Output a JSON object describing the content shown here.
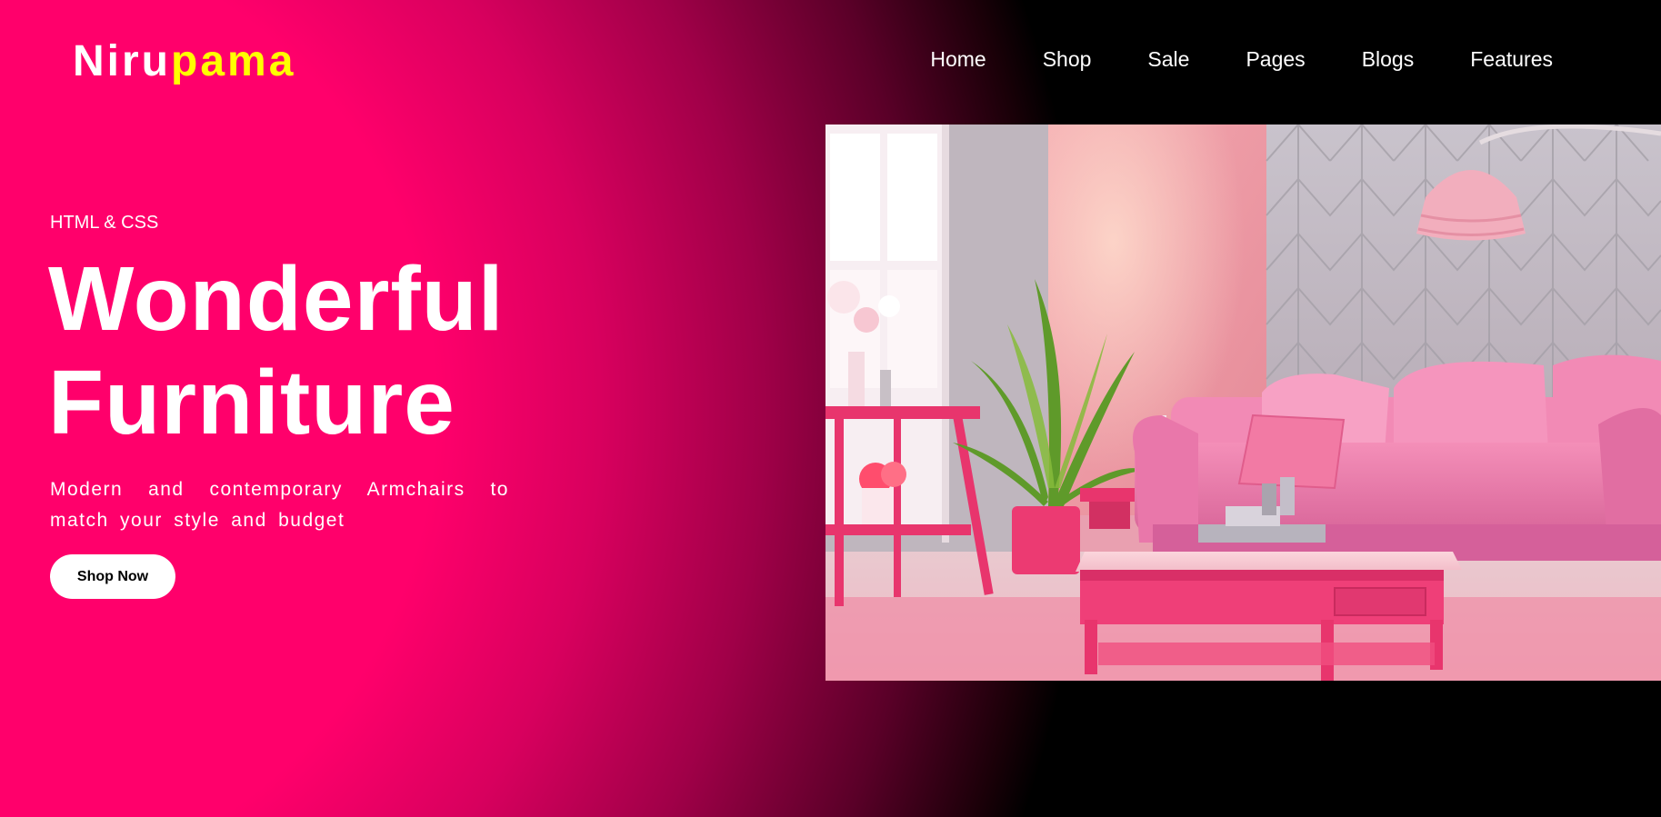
{
  "brand": {
    "part1": "Niru",
    "part2": "pama"
  },
  "nav": {
    "items": [
      "Home",
      "Shop",
      "Sale",
      "Pages",
      "Blogs",
      "Features"
    ]
  },
  "hero": {
    "eyebrow": "HTML & CSS",
    "headline_line1": "Wonderful",
    "headline_line2": "Furniture",
    "subtext": "Modern and contemporary Armchairs to match your style and budget",
    "cta_label": "Shop Now"
  },
  "colors": {
    "accent_pink": "#ff006b",
    "brand_yellow": "#ffff00",
    "text_white": "#ffffff"
  }
}
